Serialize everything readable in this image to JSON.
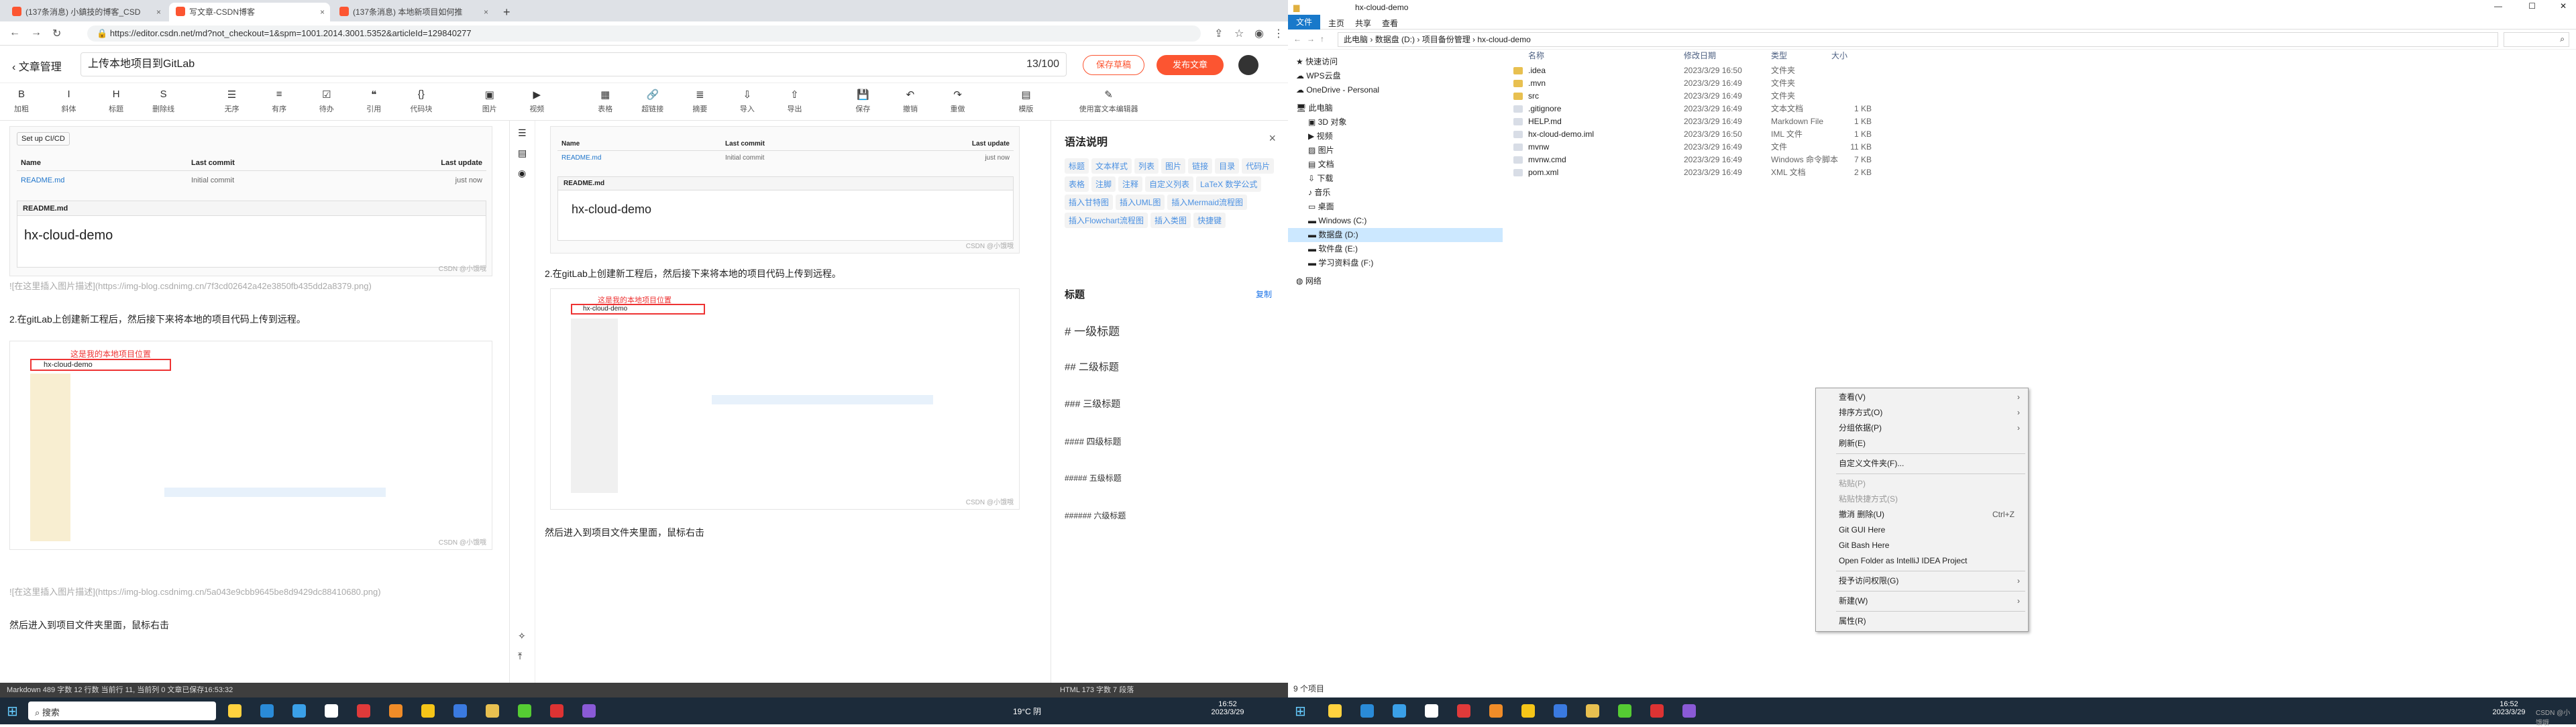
{
  "browser": {
    "tabs": [
      {
        "label": "(137条消息) 小鎮技的博客_CSD"
      },
      {
        "label": "写文章-CSDN博客"
      },
      {
        "label": "(137条消息) 本地新项目如何推"
      }
    ],
    "url": "https://editor.csdn.net/md?not_checkout=1&spm=1001.2014.3001.5352&articleId=129840277"
  },
  "editor": {
    "back_label": "文章管理",
    "title": "上传本地项目到GitLab",
    "counter": "13/100",
    "save_draft": "保存草稿",
    "publish": "发布文章",
    "toolbar": [
      "加粗",
      "斜体",
      "标题",
      "删除线",
      "无序",
      "有序",
      "待办",
      "引用",
      "代码块",
      "图片",
      "视频",
      "表格",
      "超链接",
      "摘要",
      "导入",
      "导出",
      "保存",
      "撤销",
      "重做",
      "模版",
      "使用富文本编辑器",
      "目录",
      "发文助手",
      "语法说明"
    ],
    "left_lines": [
      "![在这里插入图片描述](https://img-blog.csdnimg.cn/7f3cd02642a42e3850fb435dd2a8379.png)",
      "2.在gitLab上创建新工程后，然后接下来将本地的项目代码上传到远程。",
      "![在这里插入图片描述](https://img-blog.csdnimg.cn/5a043e9cbb9645be8d9429dc88410680.png)",
      "然后进入到项目文件夹里面，鼠标右击"
    ],
    "right_lines": [
      "2.在gitLab上创建新工程后，然后接下来将本地的项目代码上传到远程。",
      "然后进入到项目文件夹里面，鼠标右击"
    ],
    "gitlab": {
      "setup": "Set up CI/CD",
      "cols": [
        "Name",
        "Last commit",
        "Last update"
      ],
      "row": [
        "README.md",
        "Initial commit",
        "just now"
      ],
      "readme_title": "README.md",
      "h1": "hx-cloud-demo",
      "wm": "CSDN @小饿哦"
    },
    "local_annotation": "这是我的本地项目位置",
    "local_folder": "hx-cloud-demo",
    "status_left": "Markdown  489 字数  12 行数  当前行 11, 当前列 0  文章已保存16:53:32",
    "status_right": "HTML  173 字数  7 段落"
  },
  "syntax": {
    "title": "语法说明",
    "tags": [
      "标题",
      "文本样式",
      "列表",
      "图片",
      "链接",
      "目录",
      "代码片",
      "表格",
      "注脚",
      "注释",
      "自定义列表",
      "LaTeX 数学公式",
      "插入甘特图",
      "插入UML图",
      "插入Mermaid流程图",
      "插入Flowchart流程图",
      "插入类图",
      "快捷键"
    ],
    "section": "标题",
    "copy": "复制",
    "headings": [
      "# 一级标题",
      "## 二级标题",
      "### 三级标题",
      "#### 四级标题",
      "##### 五级标题",
      "###### 六级标题"
    ]
  },
  "explorer": {
    "title": "hx-cloud-demo",
    "ribbon": [
      "文件",
      "主页",
      "共享",
      "查看"
    ],
    "path": [
      "此电脑",
      "数据盘 (D:)",
      "项目备份管理",
      "hx-cloud-demo"
    ],
    "nav": [
      "快速访问",
      "WPS云盘",
      "OneDrive - Personal",
      "此电脑",
      "3D 对象",
      "视频",
      "图片",
      "文档",
      "下载",
      "音乐",
      "桌面",
      "Windows (C:)",
      "数据盘 (D:)",
      "软件盘 (E:)",
      "学习资料盘 (F:)",
      "网络"
    ],
    "cols": [
      "名称",
      "修改日期",
      "类型",
      "大小"
    ],
    "files": [
      {
        "name": ".idea",
        "date": "2023/3/29 16:50",
        "type": "文件夹",
        "size": ""
      },
      {
        "name": ".mvn",
        "date": "2023/3/29 16:49",
        "type": "文件夹",
        "size": ""
      },
      {
        "name": "src",
        "date": "2023/3/29 16:49",
        "type": "文件夹",
        "size": ""
      },
      {
        "name": ".gitignore",
        "date": "2023/3/29 16:49",
        "type": "文本文档",
        "size": "1 KB"
      },
      {
        "name": "HELP.md",
        "date": "2023/3/29 16:49",
        "type": "Markdown File",
        "size": "1 KB"
      },
      {
        "name": "hx-cloud-demo.iml",
        "date": "2023/3/29 16:50",
        "type": "IML 文件",
        "size": "1 KB"
      },
      {
        "name": "mvnw",
        "date": "2023/3/29 16:49",
        "type": "文件",
        "size": "11 KB"
      },
      {
        "name": "mvnw.cmd",
        "date": "2023/3/29 16:49",
        "type": "Windows 命令脚本",
        "size": "7 KB"
      },
      {
        "name": "pom.xml",
        "date": "2023/3/29 16:49",
        "type": "XML 文档",
        "size": "2 KB"
      }
    ],
    "count": "9 个项目"
  },
  "context_menu": [
    {
      "label": "查看(V)",
      "arrow": true
    },
    {
      "label": "排序方式(O)",
      "arrow": true
    },
    {
      "label": "分组依据(P)",
      "arrow": true
    },
    {
      "label": "刷新(E)"
    },
    {
      "sep": true
    },
    {
      "label": "自定义文件夹(F)..."
    },
    {
      "sep": true
    },
    {
      "label": "粘贴(P)",
      "dis": true
    },
    {
      "label": "粘贴快捷方式(S)",
      "dis": true
    },
    {
      "label": "撤消 删除(U)",
      "kbd": "Ctrl+Z"
    },
    {
      "label": "Git GUI Here"
    },
    {
      "label": "Git Bash Here"
    },
    {
      "label": "Open Folder as IntelliJ IDEA Project"
    },
    {
      "sep": true
    },
    {
      "label": "授予访问权限(G)",
      "arrow": true
    },
    {
      "sep": true
    },
    {
      "label": "新建(W)",
      "arrow": true
    },
    {
      "sep": true
    },
    {
      "label": "属性(R)"
    }
  ],
  "taskbar": {
    "search": "搜索",
    "weather": "19°C 阴",
    "time": "16:52",
    "date": "2023/3/29",
    "time2": "16:52",
    "date2": "2023/3/29",
    "csdn": "CSDN @小饿哦"
  }
}
